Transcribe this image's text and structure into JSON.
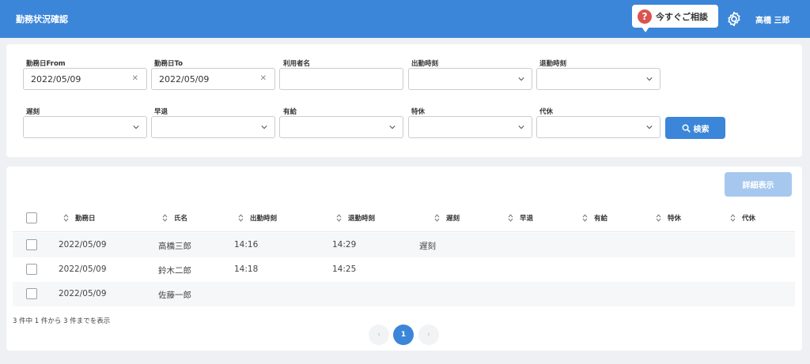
{
  "header": {
    "title": "勤務状況確認",
    "help_label": "今すぐご相談",
    "help_icon": "?",
    "user_name": "高橋 三郎"
  },
  "filters": {
    "date_from": {
      "label": "勤務日From",
      "value": "2022/05/09"
    },
    "date_to": {
      "label": "勤務日To",
      "value": "2022/05/09"
    },
    "user_name": {
      "label": "利用者名",
      "value": ""
    },
    "clock_in": {
      "label": "出勤時刻",
      "value": ""
    },
    "clock_out": {
      "label": "退勤時刻",
      "value": ""
    },
    "late": {
      "label": "遅刻",
      "value": ""
    },
    "early_leave": {
      "label": "早退",
      "value": ""
    },
    "paid_leave": {
      "label": "有給",
      "value": ""
    },
    "special_leave": {
      "label": "特休",
      "value": ""
    },
    "compensatory": {
      "label": "代休",
      "value": ""
    },
    "search_label": "検索"
  },
  "results": {
    "detail_label": "詳細表示",
    "columns": [
      "勤務日",
      "氏名",
      "出勤時刻",
      "退勤時刻",
      "遅刻",
      "早退",
      "有給",
      "特休",
      "代休"
    ],
    "rows": [
      {
        "date": "2022/05/09",
        "name": "高橋三郎",
        "in": "14:16",
        "out": "14:29",
        "late": "遅刻"
      },
      {
        "date": "2022/05/09",
        "name": "鈴木二郎",
        "in": "14:18",
        "out": "14:25",
        "late": ""
      },
      {
        "date": "2022/05/09",
        "name": "佐藤一郎",
        "in": "",
        "out": "",
        "late": ""
      }
    ],
    "count_text": "3 件中 1 件から 3 件までを表示"
  },
  "pagination": {
    "prev": "‹",
    "current": "1",
    "next": "›"
  },
  "colors": {
    "primary": "#3b86d9",
    "disabled": "#a6c8ee",
    "danger": "#d9534f"
  }
}
